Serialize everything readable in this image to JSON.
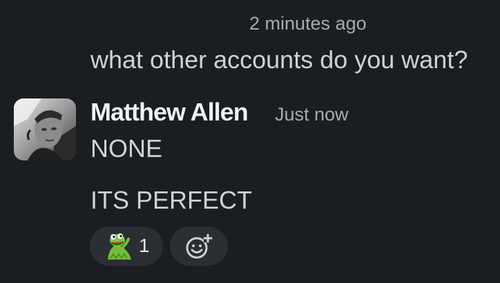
{
  "previous_message": {
    "time": "2 minutes ago",
    "text": "what other accounts do you want?"
  },
  "message": {
    "author": "Matthew Allen",
    "timestamp": "Just now",
    "lines": [
      "NONE",
      "ITS PERFECT"
    ],
    "avatar_icon": "user-avatar-photo"
  },
  "reactions": [
    {
      "emoji": "kermit-emoji",
      "count": "1"
    }
  ],
  "add_reaction_icon": "add-reaction-icon",
  "colors": {
    "background": "#1a1d21",
    "text": "#d1d2d3",
    "muted": "#a9abad",
    "pill": "#2b2e32"
  }
}
